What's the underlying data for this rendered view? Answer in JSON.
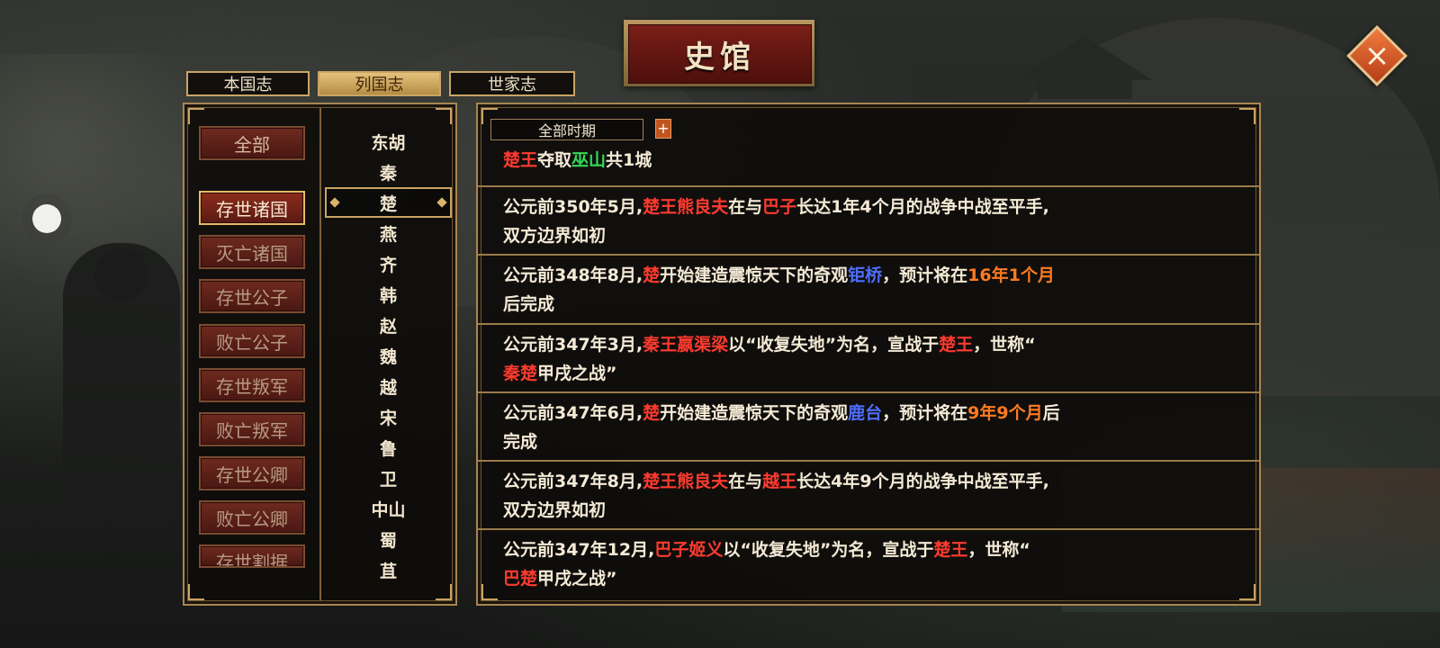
{
  "title": "史馆",
  "tabs": [
    {
      "label": "本国志",
      "active": false
    },
    {
      "label": "列国志",
      "active": true
    },
    {
      "label": "世家志",
      "active": false
    }
  ],
  "categories": [
    {
      "label": "全部",
      "active": false
    },
    {
      "label": "存世诸国",
      "active": true
    },
    {
      "label": "灭亡诸国",
      "active": false
    },
    {
      "label": "存世公子",
      "active": false
    },
    {
      "label": "败亡公子",
      "active": false
    },
    {
      "label": "存世叛军",
      "active": false
    },
    {
      "label": "败亡叛军",
      "active": false
    },
    {
      "label": "存世公卿",
      "active": false
    },
    {
      "label": "败亡公卿",
      "active": false
    },
    {
      "label": "存世割据",
      "active": false
    }
  ],
  "states": [
    {
      "label": "东胡",
      "selected": false
    },
    {
      "label": "秦",
      "selected": false
    },
    {
      "label": "楚",
      "selected": true
    },
    {
      "label": "燕",
      "selected": false
    },
    {
      "label": "齐",
      "selected": false
    },
    {
      "label": "韩",
      "selected": false
    },
    {
      "label": "赵",
      "selected": false
    },
    {
      "label": "魏",
      "selected": false
    },
    {
      "label": "越",
      "selected": false
    },
    {
      "label": "宋",
      "selected": false
    },
    {
      "label": "鲁",
      "selected": false
    },
    {
      "label": "卫",
      "selected": false
    },
    {
      "label": "中山",
      "selected": false
    },
    {
      "label": "蜀",
      "selected": false
    },
    {
      "label": "苴",
      "selected": false
    }
  ],
  "filter": {
    "period": "全部时期",
    "plus": "+"
  },
  "colors": {
    "red": "#ff3b2f",
    "green": "#33d957",
    "blue": "#4e6dff",
    "orange": "#ff7a22"
  },
  "events": [
    {
      "lines": [
        [
          {
            "t": "楚王",
            "c": "red"
          },
          {
            "t": "夺取"
          },
          {
            "t": "巫山",
            "c": "green"
          },
          {
            "t": "共1城"
          }
        ]
      ]
    },
    {
      "lines": [
        [
          {
            "t": "公元前350年5月,"
          },
          {
            "t": "楚王熊良夫",
            "c": "red"
          },
          {
            "t": "在与"
          },
          {
            "t": "巴子",
            "c": "red"
          },
          {
            "t": "长达1年4个月的战争中战至平手,"
          }
        ],
        [
          {
            "t": "双方边界如初"
          }
        ]
      ]
    },
    {
      "lines": [
        [
          {
            "t": "公元前348年8月,"
          },
          {
            "t": "楚",
            "c": "red"
          },
          {
            "t": "开始建造震惊天下的奇观"
          },
          {
            "t": "钜桥",
            "c": "blue"
          },
          {
            "t": "，预计将在"
          },
          {
            "t": "16年1个月",
            "c": "orange"
          }
        ],
        [
          {
            "t": "后完成"
          }
        ]
      ]
    },
    {
      "lines": [
        [
          {
            "t": "公元前347年3月,"
          },
          {
            "t": "秦王嬴渠梁",
            "c": "red"
          },
          {
            "t": "以“收复失地”为名，宣战于"
          },
          {
            "t": "楚王",
            "c": "red"
          },
          {
            "t": "，世称“"
          }
        ],
        [
          {
            "t": "秦楚",
            "c": "red"
          },
          {
            "t": "甲戌之战”"
          }
        ]
      ]
    },
    {
      "lines": [
        [
          {
            "t": "公元前347年6月,"
          },
          {
            "t": "楚",
            "c": "red"
          },
          {
            "t": "开始建造震惊天下的奇观"
          },
          {
            "t": "鹿台",
            "c": "blue"
          },
          {
            "t": "，预计将在"
          },
          {
            "t": "9年9个月",
            "c": "orange"
          },
          {
            "t": "后"
          }
        ],
        [
          {
            "t": "完成"
          }
        ]
      ]
    },
    {
      "lines": [
        [
          {
            "t": "公元前347年8月,"
          },
          {
            "t": "楚王熊良夫",
            "c": "red"
          },
          {
            "t": "在与"
          },
          {
            "t": "越王",
            "c": "red"
          },
          {
            "t": "长达4年9个月的战争中战至平手,"
          }
        ],
        [
          {
            "t": "双方边界如初"
          }
        ]
      ]
    },
    {
      "lines": [
        [
          {
            "t": "公元前347年12月,"
          },
          {
            "t": "巴子姬义",
            "c": "red"
          },
          {
            "t": "以“收复失地”为名，宣战于"
          },
          {
            "t": "楚王",
            "c": "red"
          },
          {
            "t": "，世称“"
          }
        ],
        [
          {
            "t": "巴楚",
            "c": "red"
          },
          {
            "t": "甲戌之战”"
          }
        ]
      ]
    }
  ]
}
